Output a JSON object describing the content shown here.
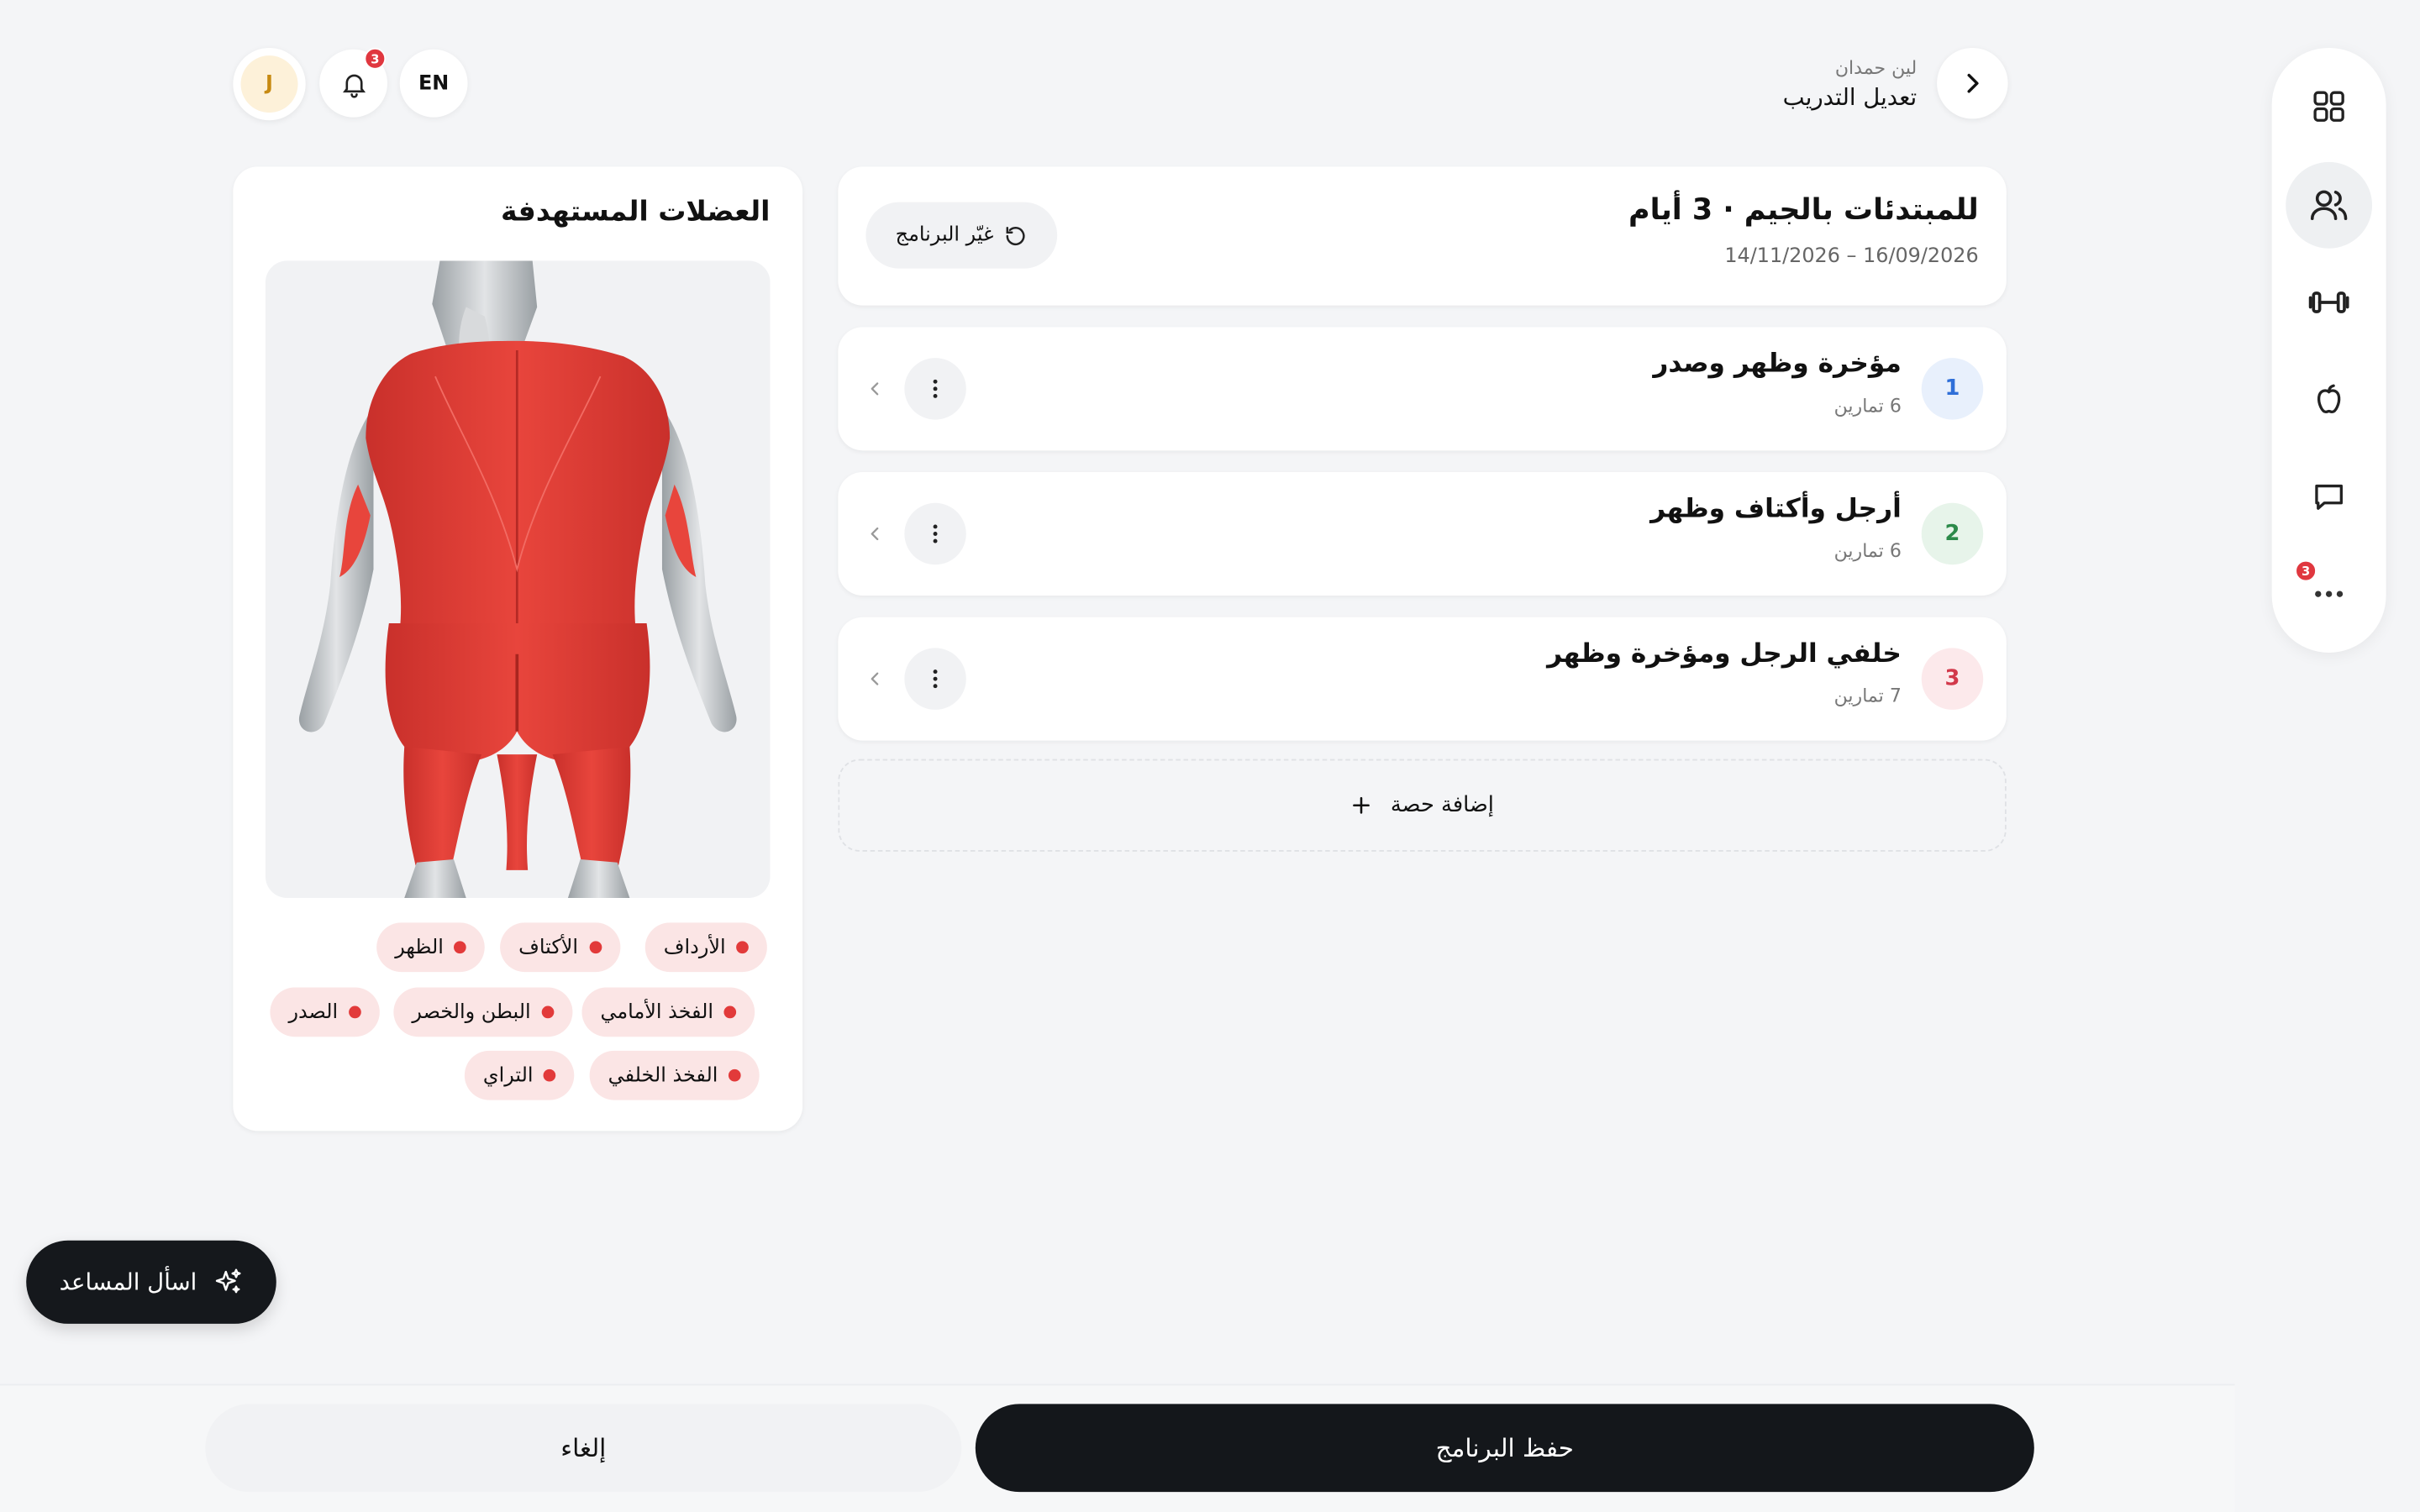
{
  "header": {
    "subtitle": "لين حمدان",
    "title": "تعديل التدريب",
    "lang_label": "EN",
    "avatar_initial": "J",
    "notifications_count": "3"
  },
  "rail": {
    "items": [
      {
        "icon": "grid-icon"
      },
      {
        "icon": "users-icon",
        "active": true
      },
      {
        "icon": "dumbbell-icon"
      },
      {
        "icon": "apple-icon"
      },
      {
        "icon": "chat-icon"
      },
      {
        "icon": "more-icon",
        "badge": "3"
      }
    ]
  },
  "program": {
    "title": "للمبتدئات بالجيم · 3 أيام",
    "dates": "14/11/2026 – 16/09/2026",
    "change_label": "غيّر البرنامج"
  },
  "sessions": [
    {
      "number": "1",
      "title": "مؤخرة وظهر وصدر",
      "count": "6 تمارين"
    },
    {
      "number": "2",
      "title": "أرجل وأكتاف وظهر",
      "count": "6 تمارين"
    },
    {
      "number": "3",
      "title": "خلفي الرجل ومؤخرة وظهر",
      "count": "7 تمارين"
    }
  ],
  "add_session_label": "إضافة حصة",
  "muscles": {
    "title": "العضلات المستهدفة",
    "chips": [
      "الأرداف",
      "الأكتاف",
      "الظهر",
      "الفخذ الأمامي",
      "البطن والخصر",
      "الصدر",
      "الفخذ الخلفي",
      "التراي"
    ]
  },
  "assistant_label": "اسأل المساعد",
  "footer": {
    "save_label": "حفظ البرنامج",
    "cancel_label": "إلغاء"
  },
  "colors": {
    "accent_dark": "#14171b",
    "muscle_red": "#e23a3a",
    "session_1": "#2f6fd8",
    "session_2": "#2c8a4a",
    "session_3": "#d2384a"
  }
}
